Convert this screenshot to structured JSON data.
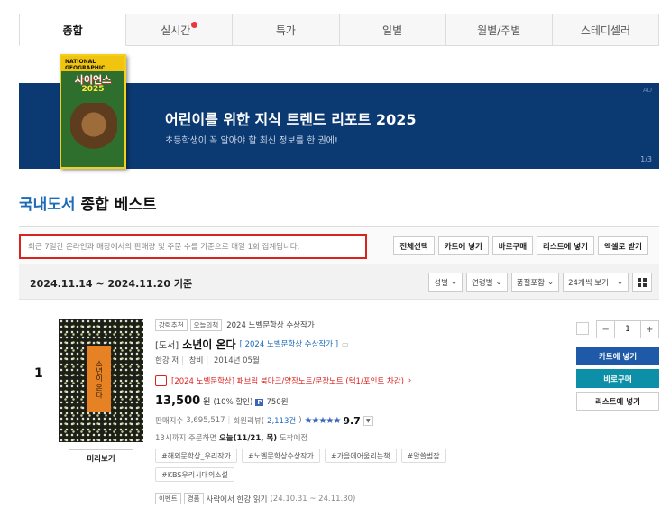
{
  "tabs": [
    {
      "label": "종합",
      "active": true
    },
    {
      "label": "실시간",
      "badge": true
    },
    {
      "label": "특가"
    },
    {
      "label": "일별"
    },
    {
      "label": "월별/주별"
    },
    {
      "label": "스테디셀러"
    }
  ],
  "banner": {
    "title": "어린이를 위한 지식 트렌드 리포트 2025",
    "subtitle": "초등학생이 꼭 알아야 할 최신 정보를 한 권에!",
    "ad": "AD",
    "page": "1/3",
    "book": {
      "brand": "NATIONAL GEOGRAPHIC",
      "title": "사이언스",
      "year": "2025"
    }
  },
  "heading": {
    "category": "국내도서",
    "title": "종합 베스트"
  },
  "notice": "최근 7일간 온라인과 매장에서의 판매량 및 주문 수를 기준으로 매일 1회 집계됩니다.",
  "actions": [
    "전체선택",
    "카트에 넣기",
    "바로구매",
    "리스트에 넣기",
    "엑셀로 받기"
  ],
  "date_range": "2024.11.14 ~ 2024.11.20 기준",
  "filters": [
    "성별",
    "연령별",
    "품절포함",
    "24개씩 보기"
  ],
  "item": {
    "rank": "1",
    "tags": [
      "강력추천",
      "오늘의책"
    ],
    "tag_text": "2024 노벨문학상 수상작가",
    "category": "[도서]",
    "title": "소년이 온다",
    "subtitle": "[ 2024 노벨문학상 수상작가 ]",
    "author": "한강",
    "author_role": "저",
    "publisher": "창비",
    "date": "2014년 05월",
    "gift": "[2024 노벨문학상] 패브릭 북마크/양장노트/문장노트 (택1/포인트 차감)",
    "price": "13,500",
    "price_unit": "원",
    "discount": "(10% 할인)",
    "points_badge": "P",
    "points": "750원",
    "sales_label": "판매지수",
    "sales": "3,695,517",
    "review_label": "회원리뷰(",
    "review_count": "2,113건",
    "review_close": ")",
    "stars": "★★★★★",
    "rating": "9.7",
    "delivery_prefix": "13시까지 주문하면",
    "delivery_date": "오늘(11/21, 목)",
    "delivery_suffix": "도착예정",
    "hashtags": [
      "#해외문학상_우리작가",
      "#노벨문학상수상작가",
      "#가을에어울리는책",
      "#알쓸범잡",
      "#KBS우리시대의소설"
    ],
    "event_tags": [
      "이벤트",
      "경품"
    ],
    "event_text": "사락에서 한강 읽기",
    "event_dates": "(24.10.31 ~ 24.11.30)",
    "cover_label": "소년이 온다",
    "preview": "미리보기",
    "quantity": "1",
    "cart": "카트에 넣기",
    "buy": "바로구매",
    "list": "리스트에 넣기"
  },
  "colors": {
    "accent_blue": "#1e6bb8",
    "banner_bg": "#0b3a73",
    "cart_btn": "#1e5aa8",
    "buy_btn": "#0d8fa8",
    "highlight_red": "#d9231f"
  }
}
